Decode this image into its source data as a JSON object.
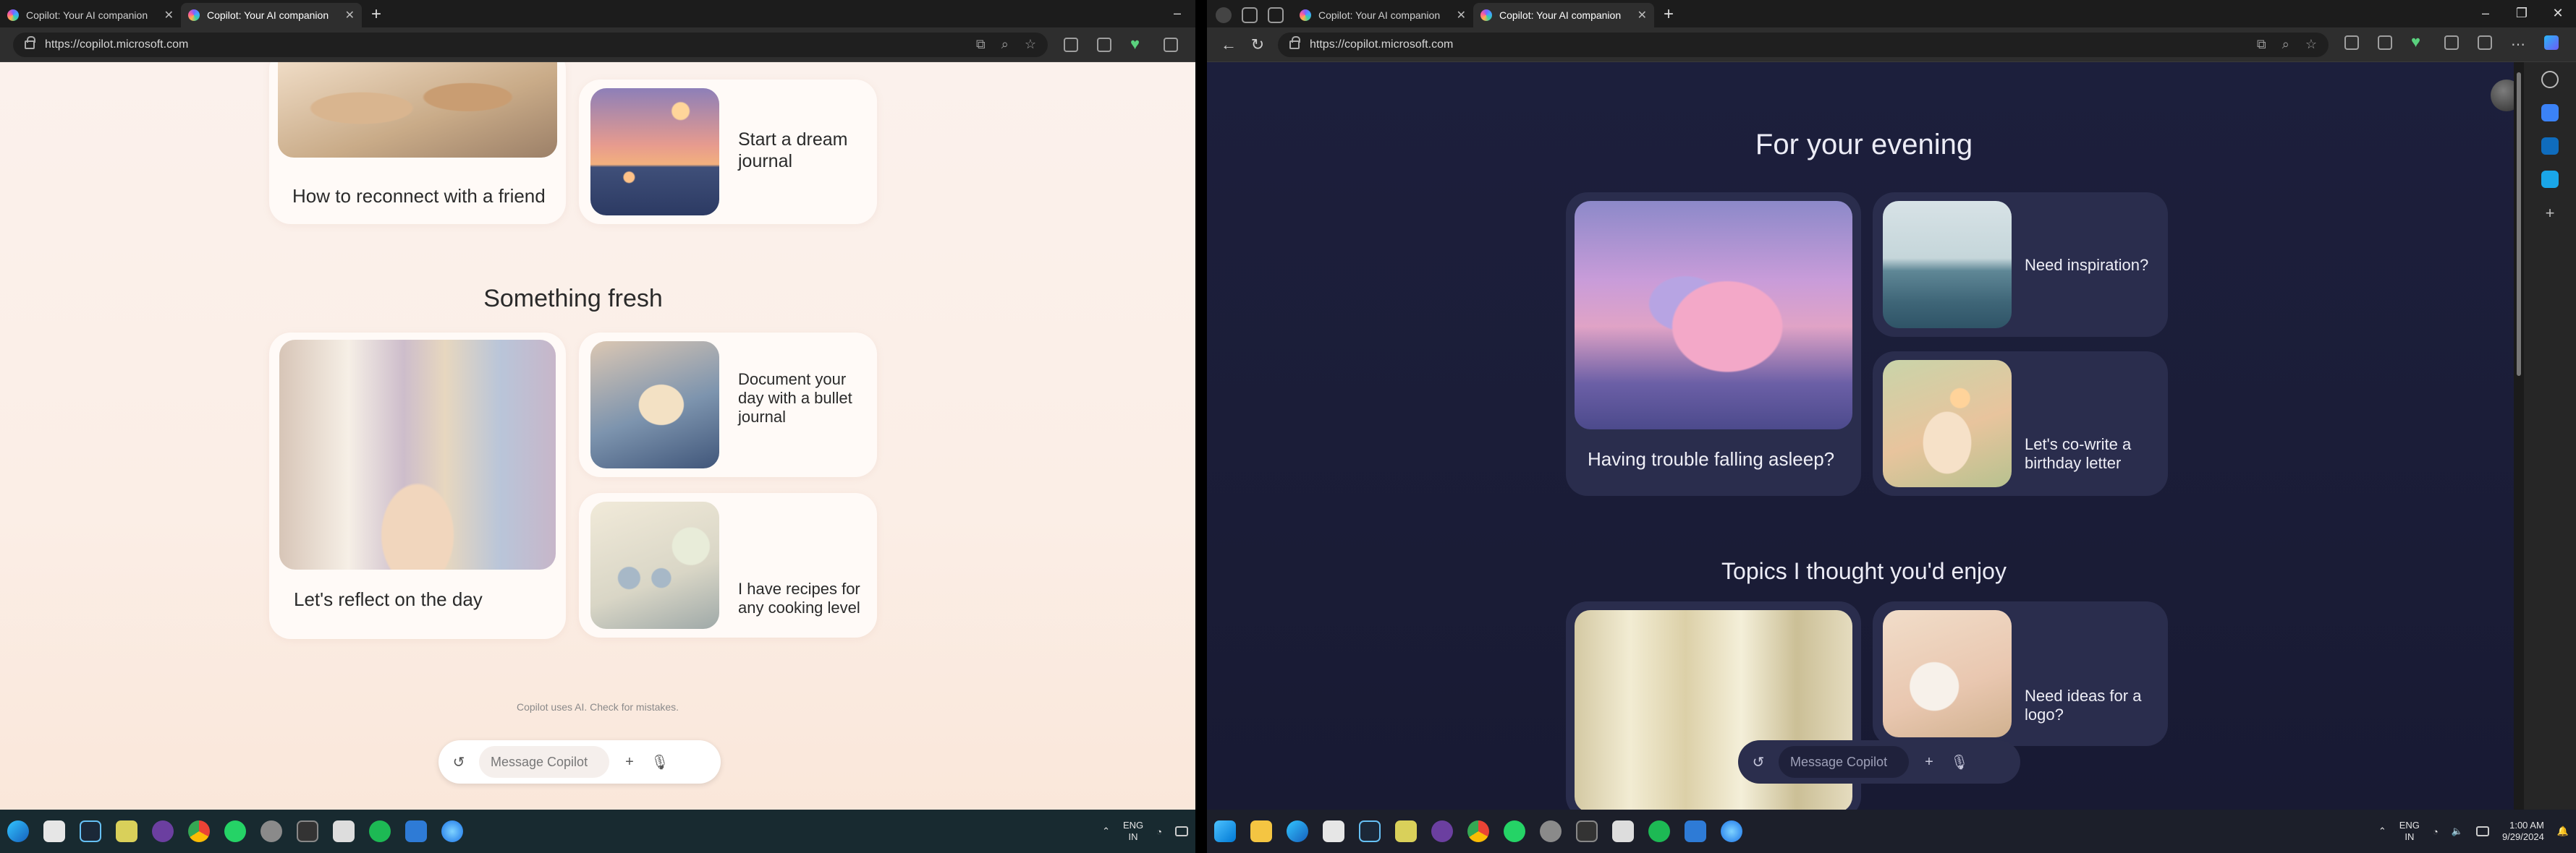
{
  "left": {
    "tabs": [
      {
        "label": "Copilot: Your AI companion",
        "active": false
      },
      {
        "label": "Copilot: Your AI companion",
        "active": true
      }
    ],
    "url": "https://copilot.microsoft.com",
    "cards_top": {
      "reconnect": "How to reconnect with a friend",
      "dream": "Start a dream journal"
    },
    "section_fresh": "Something fresh",
    "cards_fresh": {
      "reflect": "Let's reflect on the day",
      "bullet": "Document your day with a bullet journal",
      "recipes": "I have recipes for any cooking level"
    },
    "disclaimer": "Copilot uses AI. Check for mistakes.",
    "composer_placeholder": "Message Copilot",
    "tray": {
      "lang1": "ENG",
      "lang2": "IN"
    }
  },
  "right": {
    "tabs": [
      {
        "label": "Copilot: Your AI companion",
        "active": false
      },
      {
        "label": "Copilot: Your AI companion",
        "active": true
      }
    ],
    "url": "https://copilot.microsoft.com",
    "section_evening": "For your evening",
    "cards_evening": {
      "sleep": "Having trouble falling asleep?",
      "inspiration": "Need inspiration?",
      "birthday": "Let's co-write a birthday letter"
    },
    "section_topics": "Topics I thought you'd enjoy",
    "cards_topics": {
      "logo": "Need ideas for a logo?"
    },
    "composer_placeholder": "Message Copilot",
    "tray": {
      "lang1": "ENG",
      "lang2": "IN",
      "time": "1:00 AM",
      "date": "9/29/2024"
    }
  }
}
